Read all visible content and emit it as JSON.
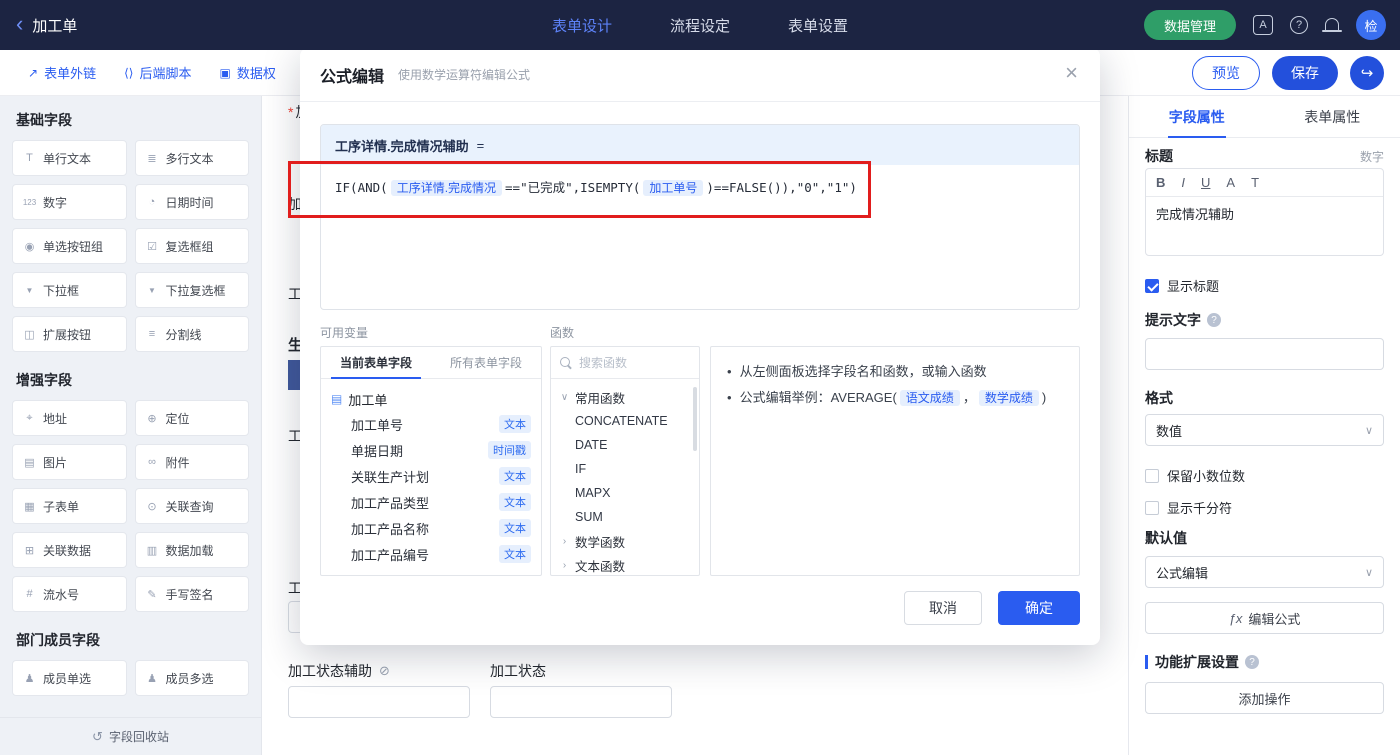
{
  "colors": {
    "primary_blue": "#2a5cf0",
    "topbar_navy": "#1c2442",
    "green_button": "#2f9e68",
    "annotation_red": "#e11d1d",
    "chip_bg": "#e6effd"
  },
  "topbar": {
    "back_icon": "‹",
    "title": "加工单",
    "nav": [
      {
        "label": "表单设计"
      },
      {
        "label": "流程设定"
      },
      {
        "label": "表单设置"
      }
    ],
    "data_manage_label": "数据管理",
    "language_icon": "A",
    "help_icon": "?",
    "avatar_text": "检"
  },
  "toolbar": {
    "items": [
      {
        "icon": "↗",
        "label": "表单外链"
      },
      {
        "icon": "⟨⟩",
        "label": "后端脚本"
      },
      {
        "icon": "▣",
        "label": "数据权"
      }
    ],
    "preview_label": "预览",
    "save_label": "保存",
    "share_icon": "↪"
  },
  "sidebar": {
    "sections": [
      {
        "title": "基础字段",
        "items": [
          {
            "icon": "T",
            "label": "单行文本"
          },
          {
            "icon": "≣",
            "label": "多行文本"
          },
          {
            "icon": "123",
            "label": "数字"
          },
          {
            "icon": "◔",
            "label": "日期时间"
          },
          {
            "icon": "◉",
            "label": "单选按钮组"
          },
          {
            "icon": "☑",
            "label": "复选框组"
          },
          {
            "icon": "▼",
            "label": "下拉框"
          },
          {
            "icon": "▼",
            "label": "下拉复选框"
          },
          {
            "icon": "◫",
            "label": "扩展按钮"
          },
          {
            "icon": "≡",
            "label": "分割线"
          }
        ]
      },
      {
        "title": "增强字段",
        "items": [
          {
            "icon": "⌖",
            "label": "地址"
          },
          {
            "icon": "⊕",
            "label": "定位"
          },
          {
            "icon": "▤",
            "label": "图片"
          },
          {
            "icon": "∞",
            "label": "附件"
          },
          {
            "icon": "▦",
            "label": "子表单"
          },
          {
            "icon": "⊙",
            "label": "关联查询"
          },
          {
            "icon": "⊞",
            "label": "关联数据"
          },
          {
            "icon": "▥",
            "label": "数据加载"
          },
          {
            "icon": "#",
            "label": "流水号"
          },
          {
            "icon": "✎",
            "label": "手写签名"
          }
        ]
      },
      {
        "title": "部门成员字段",
        "items": [
          {
            "icon": "♟",
            "label": "成员单选"
          },
          {
            "icon": "♟",
            "label": "成员多选"
          }
        ]
      }
    ],
    "recycle_icon": "↺",
    "recycle_label": "字段回收站"
  },
  "canvas": {
    "clipped_labels": [
      {
        "star": "*",
        "text": "加"
      },
      {
        "text": "加"
      },
      {
        "text": "工"
      },
      {
        "text": "生"
      },
      {
        "text": "工"
      },
      {
        "text": "工"
      }
    ],
    "field1_label": "加工状态辅助",
    "field1_icon": "⊘",
    "field2_label": "加工状态"
  },
  "right_panel": {
    "tabs": [
      {
        "label": "字段属性"
      },
      {
        "label": "表单属性"
      }
    ],
    "title_label": "标题",
    "field_type": "数字",
    "editor_tools": [
      "B",
      "I",
      "U",
      "A",
      "T"
    ],
    "title_value": "完成情况辅助",
    "show_title_label": "显示标题",
    "hint_label": "提示文字",
    "format_label": "格式",
    "format_value": "数值",
    "keep_decimals_label": "保留小数位数",
    "thousands_label": "显示千分符",
    "default_label": "默认值",
    "default_value": "公式编辑",
    "fx_icon": "ƒx",
    "edit_formula_label": "编辑公式",
    "extension_label": "功能扩展设置",
    "add_action_label": "添加操作",
    "chevron": "∨"
  },
  "modal": {
    "title": "公式编辑",
    "subtitle": "使用数学运算符编辑公式",
    "close_icon": "×",
    "target_field": "工序详情.完成情况辅助",
    "equals": "=",
    "formula": {
      "p1": "IF(AND(",
      "chip1": "工序详情.完成情况",
      "p2": "==\"已完成\",ISEMPTY(",
      "chip2": "加工单号",
      "p3": ")==FALSE()),\"0\",\"1\")"
    },
    "variables_label": "可用变量",
    "functions_label": "函数",
    "variables": {
      "tabs": [
        {
          "label": "当前表单字段"
        },
        {
          "label": "所有表单字段"
        }
      ],
      "root_icon": "▤",
      "root": "加工单",
      "fields": [
        {
          "name": "加工单号",
          "type": "文本"
        },
        {
          "name": "单据日期",
          "type": "时间戳"
        },
        {
          "name": "关联生产计划",
          "type": "文本"
        },
        {
          "name": "加工产品类型",
          "type": "文本"
        },
        {
          "name": "加工产品名称",
          "type": "文本"
        },
        {
          "name": "加工产品编号",
          "type": "文本"
        }
      ]
    },
    "functions": {
      "search_placeholder": "搜索函数",
      "groups": [
        {
          "name": "常用函数",
          "caret": "∨"
        },
        {
          "name": "数学函数",
          "caret": "›"
        },
        {
          "name": "文本函数",
          "caret": "›"
        }
      ],
      "common_items": [
        "CONCATENATE",
        "DATE",
        "IF",
        "MAPX",
        "SUM"
      ]
    },
    "help": {
      "line1": "从左侧面板选择字段名和函数，或输入函数",
      "line2_prefix": "公式编辑举例：AVERAGE(",
      "chip1": "语文成绩",
      "separator": "，",
      "chip2": "数学成绩",
      "line2_suffix": ")"
    },
    "cancel_label": "取消",
    "confirm_label": "确定"
  }
}
